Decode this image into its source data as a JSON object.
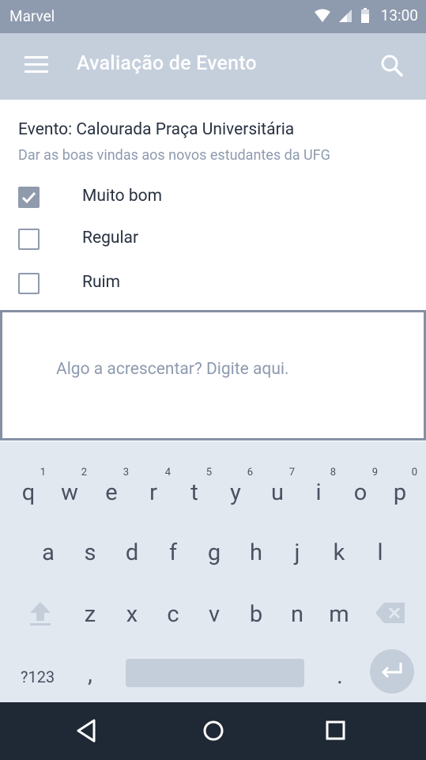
{
  "status_bar": {
    "carrier": "Marvel",
    "time": "13:00"
  },
  "app_bar": {
    "title": "Avaliação de Evento"
  },
  "event": {
    "title": "Evento: Calourada Praça Universitária",
    "subtitle": "Dar as boas vindas aos novos estudantes da UFG"
  },
  "options": [
    {
      "label": "Muito bom",
      "checked": true
    },
    {
      "label": "Regular",
      "checked": false
    },
    {
      "label": "Ruim",
      "checked": false
    }
  ],
  "comment": {
    "placeholder": "Algo a acrescentar? Digite aqui."
  },
  "keyboard": {
    "row1": [
      {
        "char": "q",
        "num": "1"
      },
      {
        "char": "w",
        "num": "2"
      },
      {
        "char": "e",
        "num": "3"
      },
      {
        "char": "r",
        "num": "4"
      },
      {
        "char": "t",
        "num": "5"
      },
      {
        "char": "y",
        "num": "6"
      },
      {
        "char": "u",
        "num": "7"
      },
      {
        "char": "i",
        "num": "8"
      },
      {
        "char": "o",
        "num": "9"
      },
      {
        "char": "p",
        "num": "0"
      }
    ],
    "row2": [
      "a",
      "s",
      "d",
      "f",
      "g",
      "h",
      "j",
      "k",
      "l"
    ],
    "row3": [
      "z",
      "x",
      "c",
      "v",
      "b",
      "n",
      "m"
    ],
    "symbols_label": "?123",
    "comma": ",",
    "period": "."
  },
  "colors": {
    "status_bar": "#8e9aae",
    "app_bar": "#c5cfdc",
    "accent": "#8f9aad",
    "nav_bar": "#1f2835",
    "keyboard": "#e2e8f0"
  }
}
